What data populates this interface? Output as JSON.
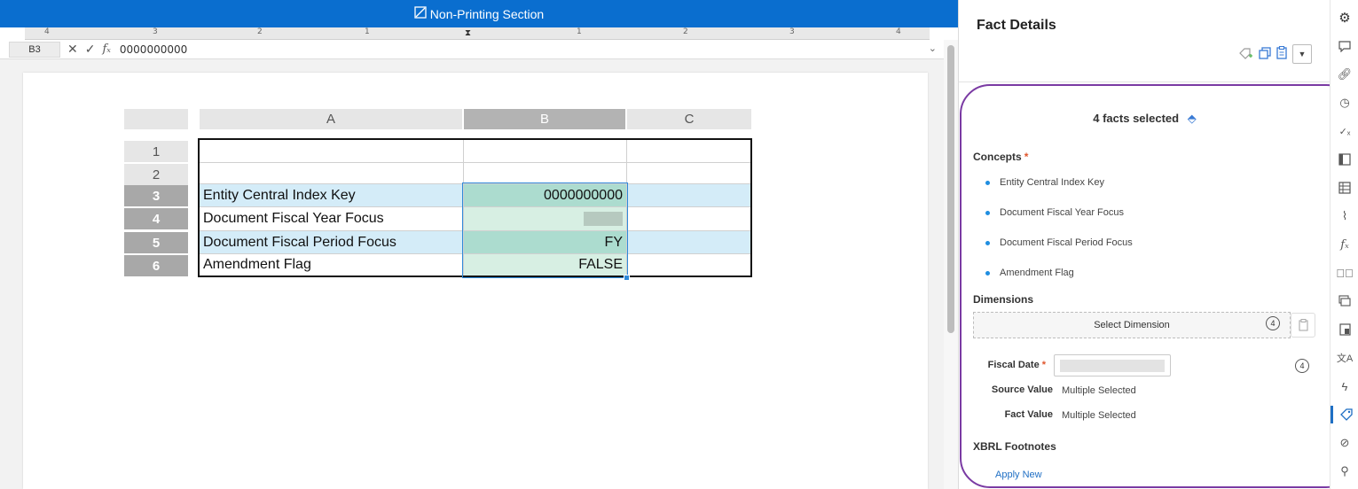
{
  "title_bar": {
    "icon": "non-printing-icon",
    "title": "Non-Printing Section"
  },
  "ruler": {
    "numbers": [
      "4",
      "3",
      "2",
      "1",
      "1",
      "2",
      "3",
      "4"
    ]
  },
  "formula_bar": {
    "cell_ref": "B3",
    "cancel_icon": "✕",
    "confirm_icon": "✓",
    "fx_icon": "fx",
    "value": "0000000000",
    "expand_icon": "chevron-down-icon"
  },
  "sheet": {
    "columns": [
      "A",
      "B",
      "C"
    ],
    "selected_column": "B",
    "row_numbers": [
      "1",
      "2",
      "3",
      "4",
      "5",
      "6"
    ],
    "selected_rows": [
      "3",
      "4",
      "5",
      "6"
    ],
    "rows": [
      {
        "a": "",
        "b": "",
        "style": "plain"
      },
      {
        "a": "",
        "b": "",
        "style": "plain"
      },
      {
        "a": "Entity Central Index Key",
        "b": "0000000000",
        "style": "blue"
      },
      {
        "a": "Document Fiscal Year Focus",
        "b": "",
        "style": "white",
        "redacted": true
      },
      {
        "a": "Document Fiscal Period Focus",
        "b": "FY",
        "style": "blue"
      },
      {
        "a": "Amendment Flag",
        "b": "FALSE",
        "style": "white"
      }
    ]
  },
  "panel": {
    "title": "Fact Details",
    "tools": [
      "tag-add-icon",
      "copy-icon",
      "clipboard-icon",
      "dropdown-icon"
    ],
    "facts_selected": "4 facts selected",
    "concepts_label": "Concepts",
    "concepts": [
      "Entity Central Index Key",
      "Document Fiscal Year Focus",
      "Document Fiscal Period Focus",
      "Amendment Flag"
    ],
    "dimensions_label": "Dimensions",
    "select_dimension": "Select Dimension",
    "dimension_count": "4",
    "fiscal_date_label": "Fiscal Date",
    "fiscal_date_count": "4",
    "source_value_label": "Source Value",
    "source_value": "Multiple Selected",
    "fact_value_label": "Fact Value",
    "fact_value": "Multiple Selected",
    "footnotes_label": "XBRL Footnotes",
    "apply_new": "Apply New"
  },
  "rail_icons": [
    "gear-icon",
    "comment-icon",
    "link-icon",
    "history-icon",
    "check-x-icon",
    "table-fx-icon",
    "table-icon",
    "paperclip-icon",
    "function-icon",
    "check-circle-icon",
    "layers-icon",
    "document-icon",
    "translate-icon",
    "lightning-icon",
    "tag-icon",
    "tag-x-icon",
    "pin-icon"
  ],
  "colors": {
    "accent": "#0a6ecf",
    "highlight": "#7a3aa3",
    "row_blue": "#d4ecf8",
    "cell_green": "#d7efe3",
    "selection": "#2f8ad9"
  }
}
